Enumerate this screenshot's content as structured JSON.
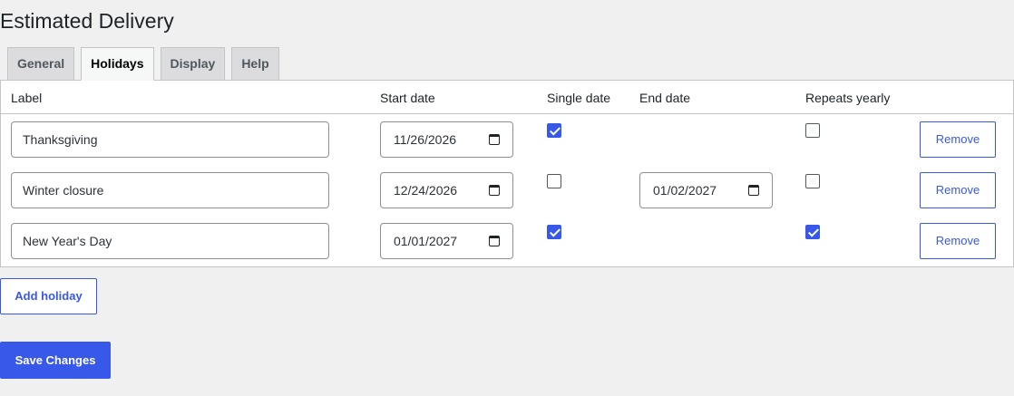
{
  "page": {
    "title": "Estimated Delivery"
  },
  "tabs": [
    {
      "label": "General",
      "active": false
    },
    {
      "label": "Holidays",
      "active": true
    },
    {
      "label": "Display",
      "active": false
    },
    {
      "label": "Help",
      "active": false
    }
  ],
  "table": {
    "headers": {
      "label": "Label",
      "start_date": "Start date",
      "single_date": "Single date",
      "end_date": "End date",
      "repeats_yearly": "Repeats yearly"
    },
    "rows": [
      {
        "label": "Thanksgiving",
        "start_date": "11/26/2026",
        "single_date": true,
        "end_date": "",
        "repeats_yearly": false,
        "remove_label": "Remove"
      },
      {
        "label": "Winter closure",
        "start_date": "12/24/2026",
        "single_date": false,
        "end_date": "01/02/2027",
        "repeats_yearly": false,
        "remove_label": "Remove"
      },
      {
        "label": "New Year's Day",
        "start_date": "01/01/2027",
        "single_date": true,
        "end_date": "",
        "repeats_yearly": true,
        "remove_label": "Remove"
      }
    ]
  },
  "actions": {
    "add_holiday": "Add holiday",
    "save_changes": "Save Changes"
  },
  "icons": {
    "date_picker": "calendar-icon"
  },
  "colors": {
    "accent": "#3858e9",
    "background": "#f0f0f1"
  }
}
